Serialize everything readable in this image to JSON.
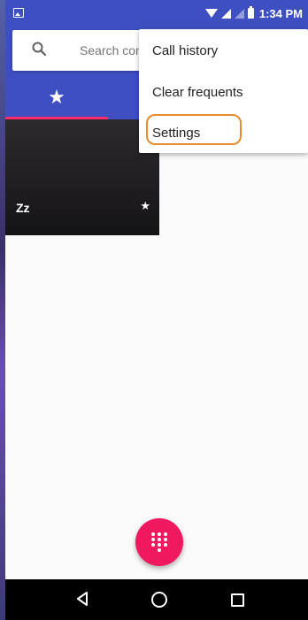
{
  "status_bar": {
    "time": "1:34 PM",
    "icons": [
      "image-icon",
      "wifi-icon",
      "signal-icon",
      "signal-icon",
      "battery-icon"
    ]
  },
  "search": {
    "placeholder": "Search con"
  },
  "tabs": [
    {
      "icon": "star-icon",
      "selected": true
    }
  ],
  "favorites": [
    {
      "name": "Zz",
      "starred": true
    }
  ],
  "menu": {
    "items": [
      {
        "label": "Call history"
      },
      {
        "label": "Clear frequents"
      },
      {
        "label": "Settings",
        "highlighted": true
      }
    ]
  },
  "fab": {
    "icon": "dialpad-icon"
  },
  "nav": {
    "icons": [
      "back-icon",
      "home-icon",
      "recents-icon"
    ]
  },
  "colors": {
    "primary": "#3d4fc1",
    "accent": "#f0185e",
    "tab_indicator": "#ff2d6f",
    "highlight_ring": "#e68b2e"
  }
}
